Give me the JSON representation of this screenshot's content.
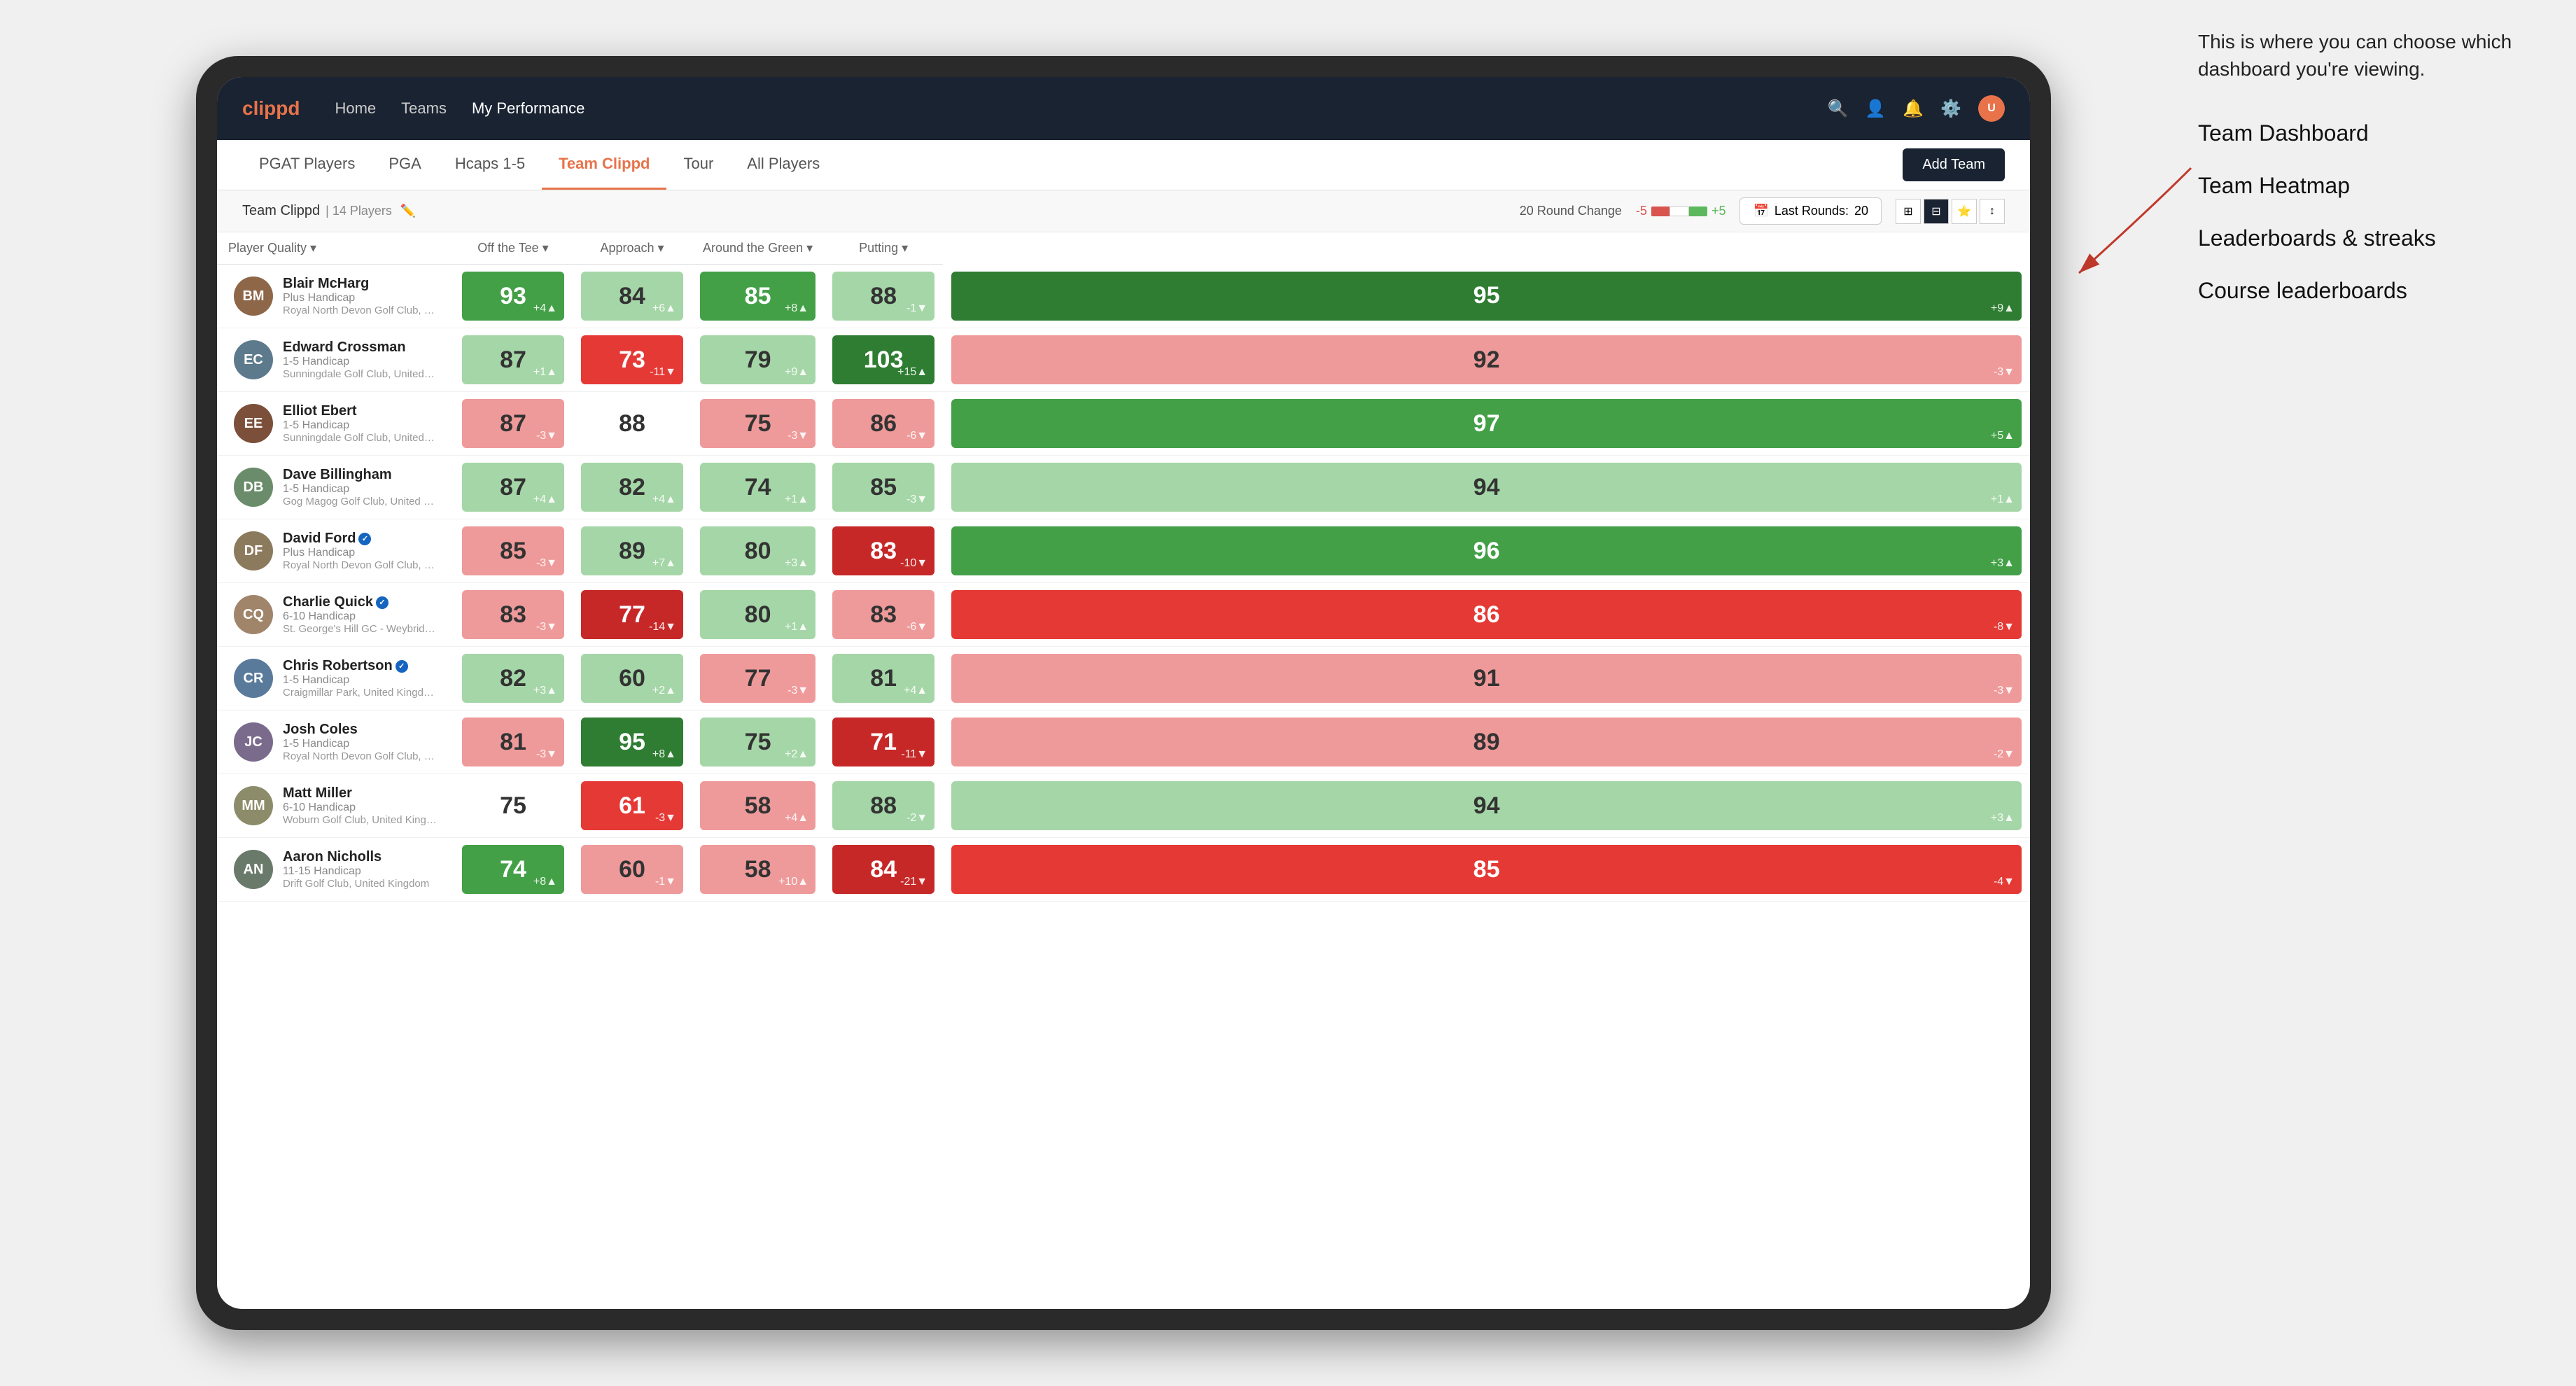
{
  "annotation": {
    "intro": "This is where you can choose which dashboard you're viewing.",
    "items": [
      "Team Dashboard",
      "Team Heatmap",
      "Leaderboards & streaks",
      "Course leaderboards"
    ]
  },
  "nav": {
    "logo": "clippd",
    "links": [
      "Home",
      "Teams",
      "My Performance"
    ],
    "active_link": "My Performance"
  },
  "sub_nav": {
    "items": [
      "PGAT Players",
      "PGA",
      "Hcaps 1-5",
      "Team Clippd",
      "Tour",
      "All Players"
    ],
    "active": "Team Clippd",
    "add_team_label": "Add Team"
  },
  "team_bar": {
    "team_name": "Team Clippd",
    "separator": "|",
    "player_count": "14 Players",
    "round_change_label": "20 Round Change",
    "neg_val": "-5",
    "pos_val": "+5",
    "last_rounds_label": "Last Rounds:",
    "last_rounds_val": "20"
  },
  "table": {
    "headers": [
      "Player Quality ▾",
      "Off the Tee ▾",
      "Approach ▾",
      "Around the Green ▾",
      "Putting ▾"
    ],
    "rows": [
      {
        "name": "Blair McHarg",
        "verified": false,
        "hcp": "Plus Handicap",
        "club": "Royal North Devon Golf Club, United Kingdom",
        "avatar_color": "#8d6748",
        "avatar_initials": "BM",
        "scores": [
          {
            "val": 93,
            "change": "+4",
            "dir": "up",
            "bg": "green-mid"
          },
          {
            "val": 84,
            "change": "+6",
            "dir": "up",
            "bg": "green-light"
          },
          {
            "val": 85,
            "change": "+8",
            "dir": "up",
            "bg": "green-mid"
          },
          {
            "val": 88,
            "change": "-1",
            "dir": "down",
            "bg": "green-light"
          },
          {
            "val": 95,
            "change": "+9",
            "dir": "up",
            "bg": "green-dark"
          }
        ]
      },
      {
        "name": "Edward Crossman",
        "verified": false,
        "hcp": "1-5 Handicap",
        "club": "Sunningdale Golf Club, United Kingdom",
        "avatar_color": "#5d7a8c",
        "avatar_initials": "EC",
        "scores": [
          {
            "val": 87,
            "change": "+1",
            "dir": "up",
            "bg": "green-light"
          },
          {
            "val": 73,
            "change": "-11",
            "dir": "down",
            "bg": "red-mid"
          },
          {
            "val": 79,
            "change": "+9",
            "dir": "up",
            "bg": "green-light"
          },
          {
            "val": 103,
            "change": "+15",
            "dir": "up",
            "bg": "green-dark"
          },
          {
            "val": 92,
            "change": "-3",
            "dir": "down",
            "bg": "red-light"
          }
        ]
      },
      {
        "name": "Elliot Ebert",
        "verified": false,
        "hcp": "1-5 Handicap",
        "club": "Sunningdale Golf Club, United Kingdom",
        "avatar_color": "#7b4f3a",
        "avatar_initials": "EE",
        "scores": [
          {
            "val": 87,
            "change": "-3",
            "dir": "down",
            "bg": "red-light"
          },
          {
            "val": 88,
            "change": "",
            "dir": "neutral",
            "bg": "white"
          },
          {
            "val": 75,
            "change": "-3",
            "dir": "down",
            "bg": "red-light"
          },
          {
            "val": 86,
            "change": "-6",
            "dir": "down",
            "bg": "red-light"
          },
          {
            "val": 97,
            "change": "+5",
            "dir": "up",
            "bg": "green-mid"
          }
        ]
      },
      {
        "name": "Dave Billingham",
        "verified": false,
        "hcp": "1-5 Handicap",
        "club": "Gog Magog Golf Club, United Kingdom",
        "avatar_color": "#6a8c6a",
        "avatar_initials": "DB",
        "scores": [
          {
            "val": 87,
            "change": "+4",
            "dir": "up",
            "bg": "green-light"
          },
          {
            "val": 82,
            "change": "+4",
            "dir": "up",
            "bg": "green-light"
          },
          {
            "val": 74,
            "change": "+1",
            "dir": "up",
            "bg": "green-light"
          },
          {
            "val": 85,
            "change": "-3",
            "dir": "down",
            "bg": "green-light"
          },
          {
            "val": 94,
            "change": "+1",
            "dir": "up",
            "bg": "green-light"
          }
        ]
      },
      {
        "name": "David Ford",
        "verified": true,
        "hcp": "Plus Handicap",
        "club": "Royal North Devon Golf Club, United Kingdom",
        "avatar_color": "#8c7a5d",
        "avatar_initials": "DF",
        "scores": [
          {
            "val": 85,
            "change": "-3",
            "dir": "down",
            "bg": "red-light"
          },
          {
            "val": 89,
            "change": "+7",
            "dir": "up",
            "bg": "green-light"
          },
          {
            "val": 80,
            "change": "+3",
            "dir": "up",
            "bg": "green-light"
          },
          {
            "val": 83,
            "change": "-10",
            "dir": "down",
            "bg": "red-dark"
          },
          {
            "val": 96,
            "change": "+3",
            "dir": "up",
            "bg": "green-mid"
          }
        ]
      },
      {
        "name": "Charlie Quick",
        "verified": true,
        "hcp": "6-10 Handicap",
        "club": "St. George's Hill GC - Weybridge, Surrey, Uni...",
        "avatar_color": "#a0856b",
        "avatar_initials": "CQ",
        "scores": [
          {
            "val": 83,
            "change": "-3",
            "dir": "down",
            "bg": "red-light"
          },
          {
            "val": 77,
            "change": "-14",
            "dir": "down",
            "bg": "red-dark"
          },
          {
            "val": 80,
            "change": "+1",
            "dir": "up",
            "bg": "green-light"
          },
          {
            "val": 83,
            "change": "-6",
            "dir": "down",
            "bg": "red-light"
          },
          {
            "val": 86,
            "change": "-8",
            "dir": "down",
            "bg": "red-mid"
          }
        ]
      },
      {
        "name": "Chris Robertson",
        "verified": true,
        "hcp": "1-5 Handicap",
        "club": "Craigmillar Park, United Kingdom",
        "avatar_color": "#5a7a9c",
        "avatar_initials": "CR",
        "scores": [
          {
            "val": 82,
            "change": "+3",
            "dir": "up",
            "bg": "green-light"
          },
          {
            "val": 60,
            "change": "+2",
            "dir": "up",
            "bg": "green-light"
          },
          {
            "val": 77,
            "change": "-3",
            "dir": "down",
            "bg": "red-light"
          },
          {
            "val": 81,
            "change": "+4",
            "dir": "up",
            "bg": "green-light"
          },
          {
            "val": 91,
            "change": "-3",
            "dir": "down",
            "bg": "red-light"
          }
        ]
      },
      {
        "name": "Josh Coles",
        "verified": false,
        "hcp": "1-5 Handicap",
        "club": "Royal North Devon Golf Club, United Kingdom",
        "avatar_color": "#7a6a8c",
        "avatar_initials": "JC",
        "scores": [
          {
            "val": 81,
            "change": "-3",
            "dir": "down",
            "bg": "red-light"
          },
          {
            "val": 95,
            "change": "+8",
            "dir": "up",
            "bg": "green-dark"
          },
          {
            "val": 75,
            "change": "+2",
            "dir": "up",
            "bg": "green-light"
          },
          {
            "val": 71,
            "change": "-11",
            "dir": "down",
            "bg": "red-dark"
          },
          {
            "val": 89,
            "change": "-2",
            "dir": "down",
            "bg": "red-light"
          }
        ]
      },
      {
        "name": "Matt Miller",
        "verified": false,
        "hcp": "6-10 Handicap",
        "club": "Woburn Golf Club, United Kingdom",
        "avatar_color": "#8c8c6a",
        "avatar_initials": "MM",
        "scores": [
          {
            "val": 75,
            "change": "",
            "dir": "neutral",
            "bg": "white"
          },
          {
            "val": 61,
            "change": "-3",
            "dir": "down",
            "bg": "red-mid"
          },
          {
            "val": 58,
            "change": "+4",
            "dir": "up",
            "bg": "red-light"
          },
          {
            "val": 88,
            "change": "-2",
            "dir": "down",
            "bg": "green-light"
          },
          {
            "val": 94,
            "change": "+3",
            "dir": "up",
            "bg": "green-light"
          }
        ]
      },
      {
        "name": "Aaron Nicholls",
        "verified": false,
        "hcp": "11-15 Handicap",
        "club": "Drift Golf Club, United Kingdom",
        "avatar_color": "#6a7a6a",
        "avatar_initials": "AN",
        "scores": [
          {
            "val": 74,
            "change": "+8",
            "dir": "up",
            "bg": "green-mid"
          },
          {
            "val": 60,
            "change": "-1",
            "dir": "down",
            "bg": "red-light"
          },
          {
            "val": 58,
            "change": "+10",
            "dir": "up",
            "bg": "red-light"
          },
          {
            "val": 84,
            "change": "-21",
            "dir": "down",
            "bg": "red-dark"
          },
          {
            "val": 85,
            "change": "-4",
            "dir": "down",
            "bg": "red-mid"
          }
        ]
      }
    ]
  }
}
